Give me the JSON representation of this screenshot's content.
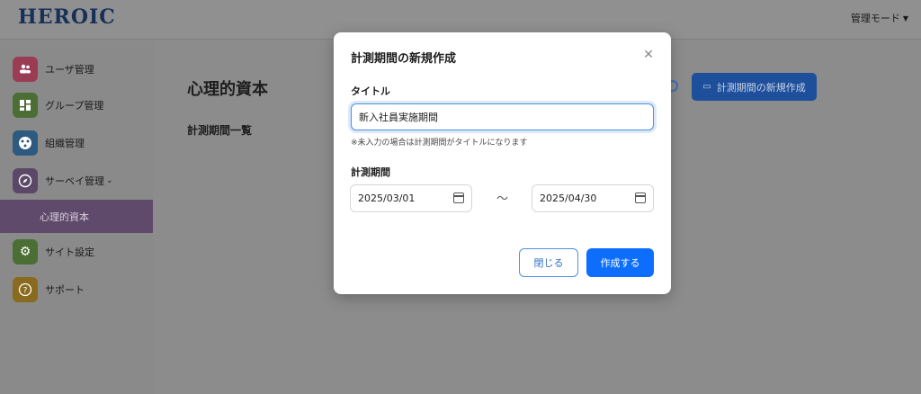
{
  "header": {
    "logo": "HEROIC",
    "mode_label": "管理モード"
  },
  "sidebar": {
    "items": [
      {
        "label": "ユーザ管理",
        "icon": "users-icon",
        "color": "#9b3c55"
      },
      {
        "label": "グループ管理",
        "icon": "grid-icon",
        "color": "#4a6e33"
      },
      {
        "label": "組織管理",
        "icon": "org-icon",
        "color": "#2c5a80"
      },
      {
        "label": "サーベイ管理",
        "icon": "compass-icon",
        "color": "#5b4868"
      },
      {
        "label": "サイト設定",
        "icon": "gear-icon",
        "color": "#4a6e33"
      },
      {
        "label": "サポート",
        "icon": "help-icon",
        "color": "#8a6a1e"
      }
    ],
    "sub_item": "心理的資本"
  },
  "main": {
    "title": "心理的資本",
    "section": "計測期間一覧",
    "create_button": "計測期間の新規作成"
  },
  "modal": {
    "title": "計測期間の新規作成",
    "title_label": "タイトル",
    "title_value": "新入社員実施期間",
    "hint": "※未入力の場合は計測期間がタイトルになります",
    "period_label": "計測期間",
    "start_date": "2025/03/01",
    "end_date": "2025/04/30",
    "separator": "～",
    "close_button": "閉じる",
    "create_button": "作成する"
  },
  "colors": {
    "primary": "#0d6efd",
    "overlay": "#8c8c8c"
  }
}
